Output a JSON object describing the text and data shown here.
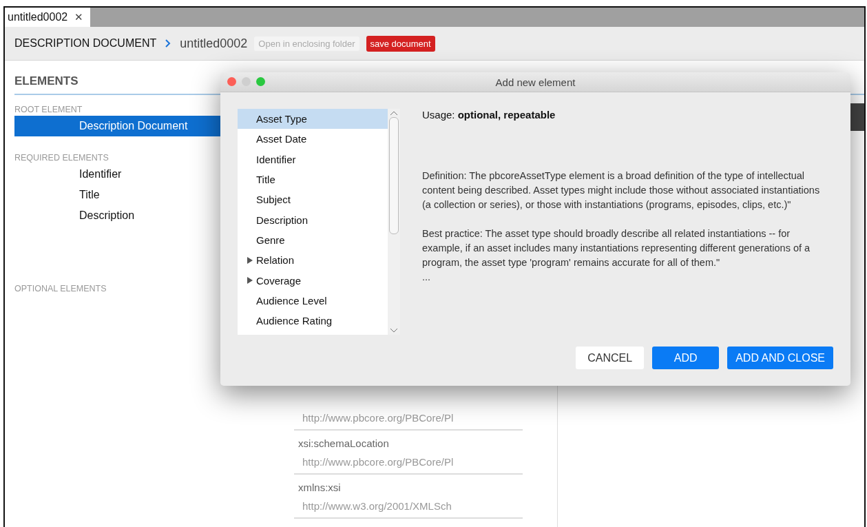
{
  "tab": {
    "label": "untitled0002",
    "close": "✕",
    "selected": true
  },
  "breadcrumb": {
    "root": "DESCRIPTION DOCUMENT",
    "current": "untitled0002",
    "open_folder": "Open in enclosing folder",
    "save": "save document"
  },
  "elements": {
    "title": "ELEMENTS",
    "sections": [
      {
        "heading": "ROOT ELEMENT",
        "items": [
          {
            "label": "Description Document",
            "selected": true
          }
        ]
      },
      {
        "heading": "REQUIRED ELEMENTS",
        "items": [
          {
            "label": "Identifier",
            "selected": false
          },
          {
            "label": "Title",
            "selected": false
          },
          {
            "label": "Description",
            "selected": false
          }
        ]
      },
      {
        "heading": "OPTIONAL ELEMENTS"
      }
    ]
  },
  "attributes": [
    {
      "value": "http://www.pbcore.org/PBCore/Pl"
    },
    {
      "label": "xsi:schemaLocation",
      "value": "http://www.pbcore.org/PBCore/Pl"
    },
    {
      "label": "xmlns:xsi",
      "value": "http://www.w3.org/2001/XMLSch"
    }
  ],
  "dialog": {
    "title": "Add new element",
    "list": [
      {
        "label": "Asset Type",
        "selected": true
      },
      {
        "label": "Asset Date",
        "selected": false
      },
      {
        "label": "Identifier",
        "selected": false
      },
      {
        "label": "Title",
        "selected": false
      },
      {
        "label": "Subject",
        "selected": false
      },
      {
        "label": "Description",
        "selected": false
      },
      {
        "label": "Genre",
        "selected": false
      },
      {
        "label": "Relation",
        "selected": false,
        "expanded": false
      },
      {
        "label": "Coverage",
        "selected": false,
        "expanded": false
      },
      {
        "label": "Audience Level",
        "selected": false
      },
      {
        "label": "Audience Rating",
        "selected": false
      }
    ],
    "usage": "Usage: **optional, repeatable**",
    "definition": "Definition: The pbcoreAssetType element is a broad definition of the type of intellectual content being described. Asset types might include those without associated instantiations (a collection or series), or those with instantiations (programs, episodes, clips, etc.)\"",
    "best_practice": "Best practice: The asset type should broadly describe all related instantiations -- for example, if an asset includes many instantiations representing different generations of a program, the asset type 'program' remains accurate for all of them.\"",
    "more": "...",
    "buttons": [
      {
        "label": "CANCEL",
        "kind": "secondary"
      },
      {
        "label": "ADD",
        "kind": "primary"
      },
      {
        "label": "ADD AND CLOSE",
        "kind": "primary"
      }
    ]
  }
}
